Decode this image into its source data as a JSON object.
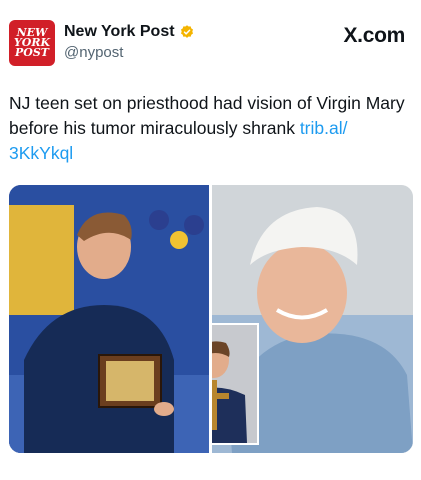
{
  "account": {
    "logo_lines": [
      "NEW",
      "YORK",
      "POST"
    ],
    "display_name": "New York Post",
    "handle": "@nypost",
    "verified_icon": "verified-badge-icon",
    "logo_color": "#d11f28",
    "verified_color": "#f4b400"
  },
  "brand": "X.com",
  "tweet": {
    "text": "NJ teen set on priesthood had vision of Virgin Mary before his tumor miraculously shrank ",
    "link_text": "trib.al/\n3KkYkql",
    "link_color": "#1d9bf0"
  },
  "media": {
    "count": 2,
    "images": [
      {
        "name": "teen-with-plaque-photo"
      },
      {
        "name": "teen-in-hospital-bed-photo"
      }
    ]
  }
}
